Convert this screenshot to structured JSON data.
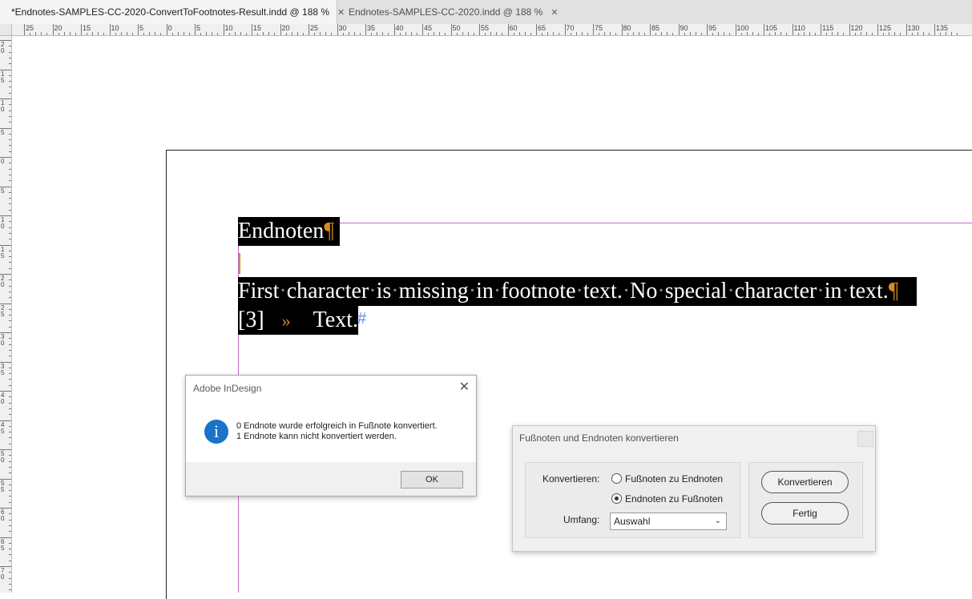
{
  "tabs": [
    {
      "label": "*Endnotes-SAMPLES-CC-2020-ConvertToFootnotes-Result.indd @ 188 %",
      "close": "✕"
    },
    {
      "label": "Endnotes-SAMPLES-CC-2020.indd @ 188 %",
      "close": "✕"
    }
  ],
  "ruler": {
    "top_labels": [
      "25",
      "20",
      "15",
      "10",
      "5",
      "0",
      "5",
      "10",
      "15",
      "20",
      "25",
      "30",
      "35",
      "40",
      "45",
      "50",
      "55",
      "60",
      "65",
      "70",
      "75",
      "80",
      "85",
      "90",
      "95",
      "100",
      "105",
      "110",
      "115",
      "120",
      "125",
      "130",
      "135"
    ],
    "left_labels": [
      "2\n0",
      "1\n5",
      "1\n0",
      "5",
      "0",
      "5",
      "1\n0",
      "1\n5",
      "2\n0",
      "2\n5",
      "3\n0",
      "3\n5",
      "4\n0",
      "4\n5",
      "5\n0",
      "5\n5",
      "6\n0",
      "6\n5",
      "7\n0"
    ]
  },
  "document": {
    "heading": "Endnoten",
    "pilcrow": "¶",
    "line2_parts": [
      "First",
      "character",
      "is",
      "missing",
      "in",
      "footnote",
      "text.",
      "No",
      "special",
      "character",
      "in",
      "text."
    ],
    "dot": "·",
    "line3_num": "[3]",
    "line3_tab": "»",
    "line3_text": "Text.",
    "end_mark": "#"
  },
  "alert": {
    "title": "Adobe InDesign",
    "close": "✕",
    "icon": "i",
    "icon_name": "info-icon",
    "line1": "0 Endnote wurde erfolgreich in Fußnote konvertiert.",
    "line2": "1 Endnote kann nicht konvertiert werden.",
    "ok": "OK"
  },
  "convert_dialog": {
    "title": "Fußnoten und Endnoten konvertieren",
    "convert_label": "Konvertieren:",
    "option1": "Fußnoten zu Endnoten",
    "option2": "Endnoten zu Fußnoten",
    "selected_option": 2,
    "scope_label": "Umfang:",
    "scope_value": "Auswahl",
    "convert_button": "Konvertieren",
    "done_button": "Fertig"
  },
  "colors": {
    "margin_guide": "#c56bc5",
    "hidden_chars": "#d98a1e",
    "info_icon": "#1a73c8"
  }
}
